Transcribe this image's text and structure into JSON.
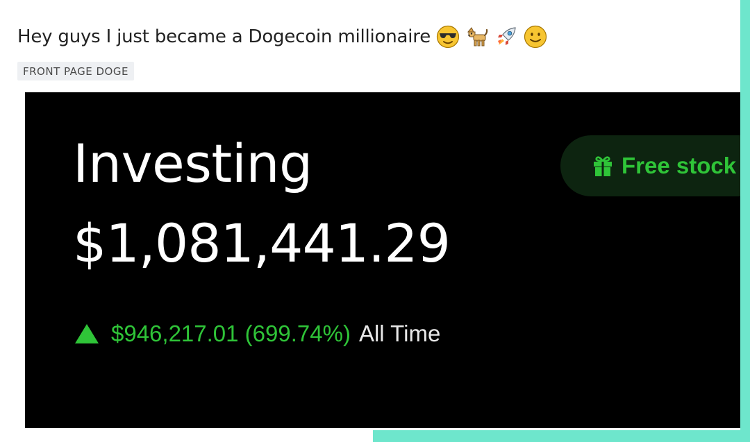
{
  "post": {
    "title": "Hey guys I just became a Dogecoin millionaire",
    "emojis": [
      "sunglasses-face-icon",
      "dog-icon",
      "rocket-icon",
      "smiling-face-icon"
    ],
    "flair": "FRONT PAGE DOGE"
  },
  "portfolio": {
    "heading": "Investing",
    "balance": "$1,081,441.29",
    "change_value": "$946,217.01 (699.74%)",
    "change_period": "All Time",
    "change_direction_icon": "triangle-up-icon",
    "free_stock_label": "Free stock",
    "free_stock_icon": "gift-icon"
  },
  "colors": {
    "frame_accent": "#6ee6cc",
    "app_background": "#000000",
    "positive_green": "#2fc438",
    "button_background": "#0d2410",
    "title_text": "#222222",
    "flair_background": "#eef0f3"
  }
}
